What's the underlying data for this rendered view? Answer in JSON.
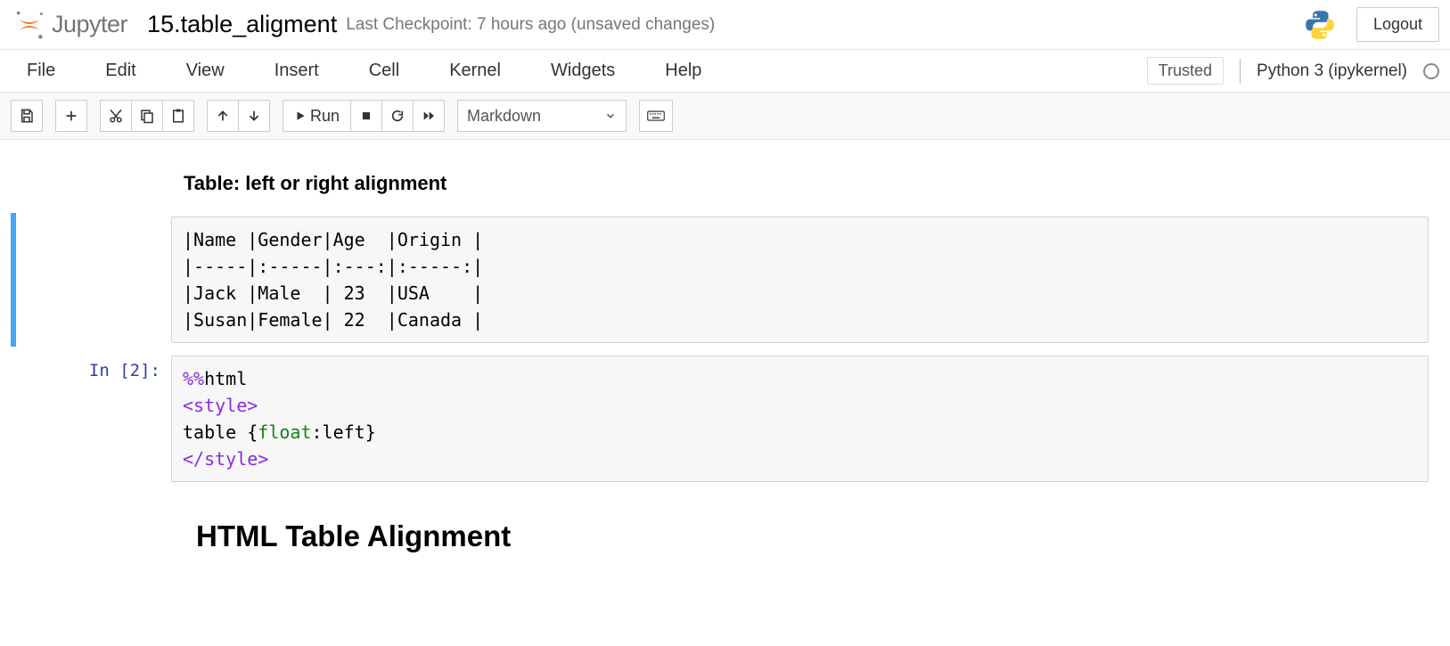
{
  "header": {
    "logo_text": "Jupyter",
    "notebook_name": "15.table_aligment",
    "checkpoint": "Last Checkpoint: 7 hours ago   (unsaved changes)",
    "logout": "Logout"
  },
  "menubar": {
    "items": [
      "File",
      "Edit",
      "View",
      "Insert",
      "Cell",
      "Kernel",
      "Widgets",
      "Help"
    ],
    "trusted": "Trusted",
    "kernel": "Python 3 (ipykernel)"
  },
  "toolbar": {
    "run_label": "Run",
    "celltype": "Markdown"
  },
  "cells": {
    "md_title": "Table: left or right alignment",
    "md_code": "|Name |Gender|Age  |Origin |\n|-----|:-----|:---:|:-----:|\n|Jack |Male  | 23  |USA    |\n|Susan|Female| 22  |Canada |",
    "code_prompt": "In [2]:",
    "code_lines": {
      "l1_magic": "%%",
      "l1_rest": "html",
      "l2_open": "<style>",
      "l3_pre": "table {",
      "l3_prop": "float",
      "l3_rest": ":left}",
      "l4_close": "</style>"
    },
    "h1": "HTML Table Alignment"
  }
}
